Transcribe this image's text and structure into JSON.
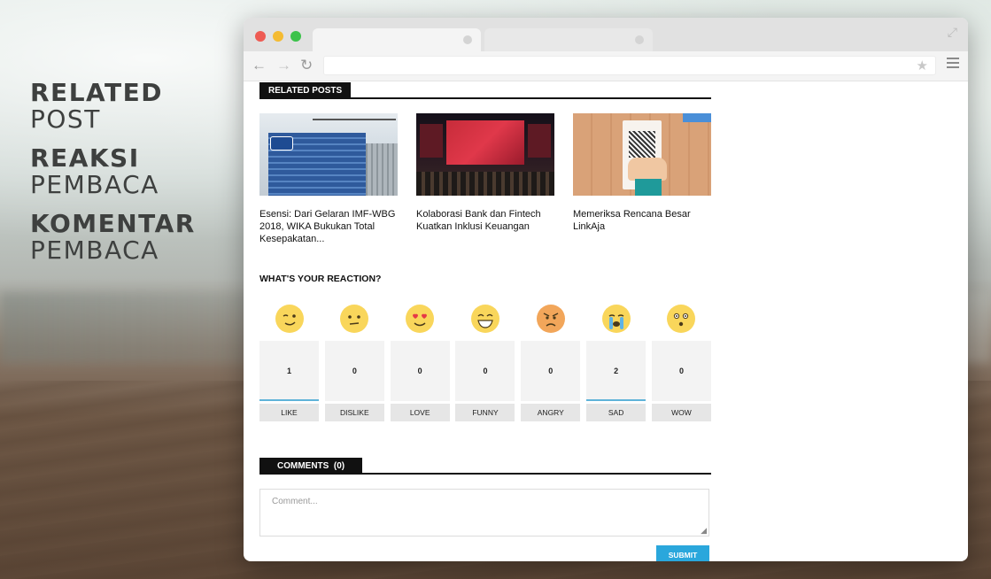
{
  "side_labels": [
    {
      "bold": "RELATED",
      "light": "POST"
    },
    {
      "bold": "REAKSI",
      "light": "PEMBACA"
    },
    {
      "bold": "KOMENTAR",
      "light": "PEMBACA"
    }
  ],
  "browser": {
    "nav_back": "←",
    "nav_forward": "→",
    "nav_reload": "↻",
    "star": "★",
    "expand": "⤢"
  },
  "related": {
    "header": "RELATED POSTS",
    "posts": [
      {
        "title": "Esensi: Dari Gelaran IMF-WBG 2018, WIKA Bukukan Total Kesepakatan..."
      },
      {
        "title": "Kolaborasi Bank dan Fintech Kuatkan Inklusi Keuangan"
      },
      {
        "title": "Memeriksa Rencana Besar LinkAja"
      }
    ]
  },
  "reactions": {
    "title": "WHAT'S YOUR REACTION?",
    "items": [
      {
        "label": "LIKE",
        "count": "1",
        "icon": "wink-emoji-icon",
        "active": true
      },
      {
        "label": "DISLIKE",
        "count": "0",
        "icon": "unamused-emoji-icon",
        "active": false
      },
      {
        "label": "LOVE",
        "count": "0",
        "icon": "heart-eyes-emoji-icon",
        "active": false
      },
      {
        "label": "FUNNY",
        "count": "0",
        "icon": "grinning-emoji-icon",
        "active": false
      },
      {
        "label": "ANGRY",
        "count": "0",
        "icon": "angry-emoji-icon",
        "active": false
      },
      {
        "label": "SAD",
        "count": "2",
        "icon": "crying-emoji-icon",
        "active": true
      },
      {
        "label": "WOW",
        "count": "0",
        "icon": "surprised-emoji-icon",
        "active": false
      }
    ]
  },
  "comments": {
    "header_label": "COMMENTS",
    "header_count": "(0)",
    "placeholder": "Comment...",
    "submit_label": "SUBMIT"
  },
  "colors": {
    "accent": "#2aa7dc",
    "active_bar": "#5fb3d9",
    "header_bg": "#111111"
  }
}
